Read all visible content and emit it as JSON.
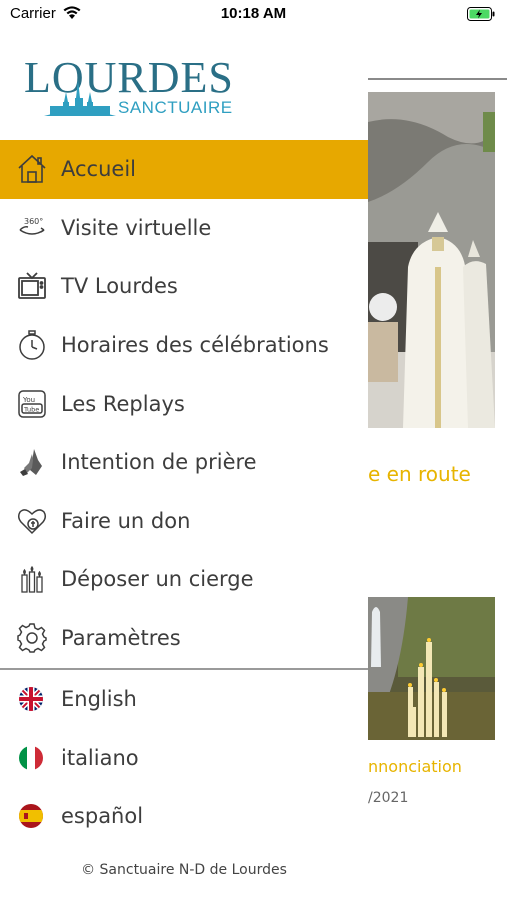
{
  "status_bar": {
    "carrier": "Carrier",
    "time": "10:18 AM"
  },
  "logo": {
    "title": "LOURDES",
    "subtitle": "SANCTUAIRE"
  },
  "menu": {
    "items": [
      {
        "label": "Accueil",
        "icon": "home-icon",
        "active": true
      },
      {
        "label": "Visite virtuelle",
        "icon": "360-view-icon"
      },
      {
        "label": "TV Lourdes",
        "icon": "tv-icon"
      },
      {
        "label": "Horaires des célébrations",
        "icon": "stopwatch-icon"
      },
      {
        "label": "Les Replays",
        "icon": "youtube-icon"
      },
      {
        "label": "Intention de prière",
        "icon": "praying-hands-icon"
      },
      {
        "label": "Faire un don",
        "icon": "heart-donation-icon"
      },
      {
        "label": "Déposer un cierge",
        "icon": "candles-icon"
      },
      {
        "label": "Paramètres",
        "icon": "gear-icon"
      }
    ]
  },
  "languages": [
    {
      "label": "English",
      "icon": "uk-flag-icon"
    },
    {
      "label": "italiano",
      "icon": "italy-flag-icon"
    },
    {
      "label": "español",
      "icon": "spain-flag-icon"
    }
  ],
  "footer": {
    "copyright": "© Sanctuaire N-D de Lourdes"
  },
  "background": {
    "text1": "e en route",
    "text2": "nnonciation",
    "text3": "/2021"
  },
  "colors": {
    "accent": "#e7a800",
    "logo_blue": "#2a6f86",
    "highlight_text": "#e7b400"
  }
}
